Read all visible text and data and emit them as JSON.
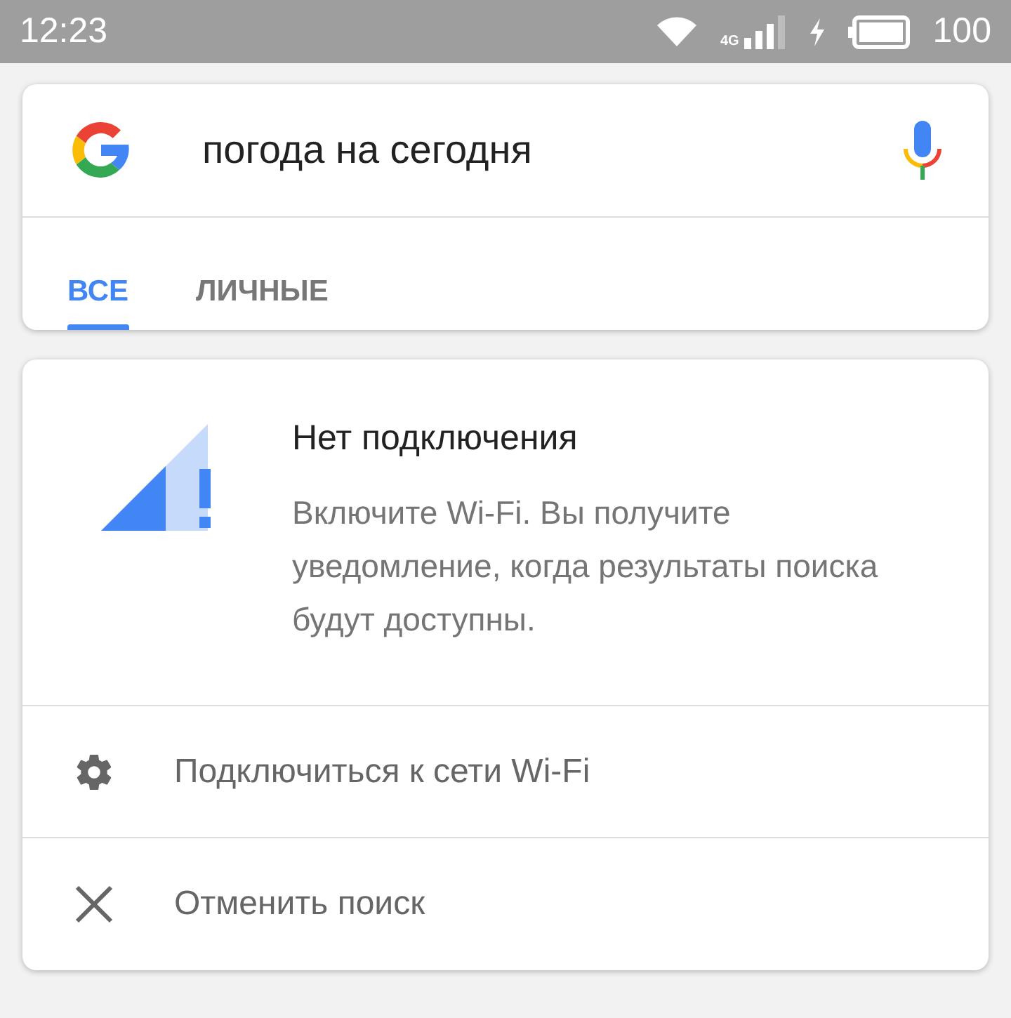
{
  "status_bar": {
    "time": "12:23",
    "network": "4G",
    "battery": "100"
  },
  "search": {
    "value": "погода на сегодня"
  },
  "tabs": [
    {
      "label": "ВСЕ",
      "selected": true
    },
    {
      "label": "ЛИЧНЫЕ",
      "selected": false
    }
  ],
  "message": {
    "title": "Нет подключения",
    "body": "Включите Wi-Fi. Вы получите уведомление, когда результаты поиска будут доступны."
  },
  "actions": [
    {
      "kind": "settings",
      "label": "Подключиться к сети Wi-Fi"
    },
    {
      "kind": "close",
      "label": "Отменить поиск"
    }
  ]
}
